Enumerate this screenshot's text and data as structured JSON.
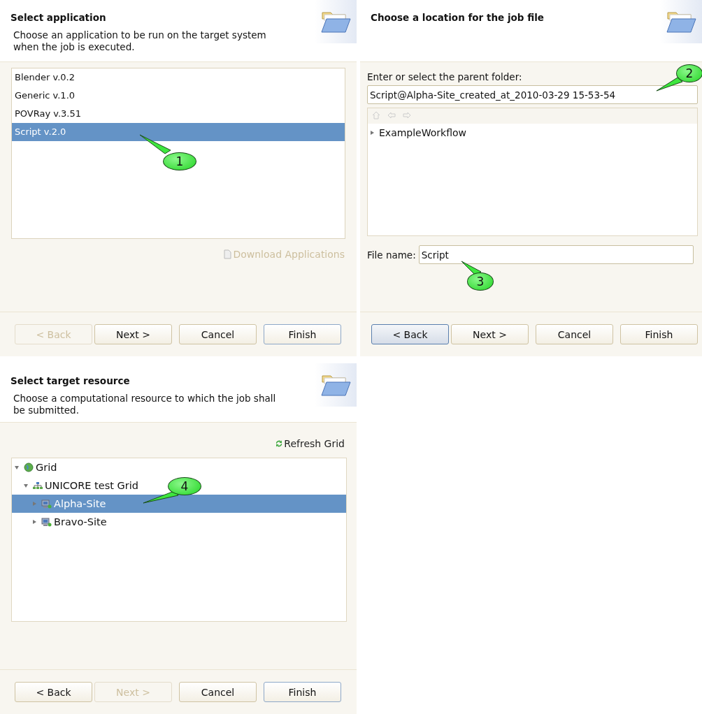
{
  "panels": [
    {
      "kind": "applications",
      "title": "Select application",
      "description": "Choose an application to be run on the target system when the job is executed.",
      "items": [
        {
          "label": "Blender v.0.2",
          "selected": false
        },
        {
          "label": "Generic v.1.0",
          "selected": false
        },
        {
          "label": "POVRay v.3.51",
          "selected": false
        },
        {
          "label": "Script v.2.0",
          "selected": true
        }
      ],
      "link": {
        "label": "Download Applications",
        "disabled": true
      },
      "buttons": [
        {
          "label": "< Back",
          "disabled": true,
          "focused": false,
          "default": false
        },
        {
          "label": "Next >",
          "disabled": false,
          "focused": false,
          "default": false
        },
        {
          "label": "Cancel",
          "disabled": false,
          "focused": false,
          "default": false
        },
        {
          "label": "Finish",
          "disabled": false,
          "focused": false,
          "default": true
        }
      ],
      "callouts": [
        "1"
      ]
    },
    {
      "kind": "location",
      "title": "Choose a location for the job file",
      "folder_label": "Enter or select the parent folder:",
      "folder_value": "Script@Alpha-Site_created_at_2010-03-29 15-53-54",
      "tree": [
        {
          "label": "ExampleWorkflow",
          "expanded": false,
          "selected": false
        }
      ],
      "file_label": "File name:",
      "file_value": "Script",
      "buttons": [
        {
          "label": "< Back",
          "disabled": false,
          "focused": true,
          "default": false
        },
        {
          "label": "Next >",
          "disabled": false,
          "focused": false,
          "default": false
        },
        {
          "label": "Cancel",
          "disabled": false,
          "focused": false,
          "default": false
        },
        {
          "label": "Finish",
          "disabled": false,
          "focused": false,
          "default": false
        }
      ],
      "callouts": [
        "2",
        "3"
      ]
    },
    {
      "kind": "resource",
      "title": "Select target resource",
      "description": "Choose a computational resource to which the job shall be submitted.",
      "link": {
        "label": "Refresh Grid",
        "disabled": false
      },
      "tree": [
        {
          "label": "Grid",
          "kind": "grid",
          "expanded": true,
          "selected": false,
          "children": [
            {
              "label": "UNICORE test Grid",
              "kind": "group",
              "expanded": true,
              "selected": false,
              "children": [
                {
                  "label": "Alpha-Site",
                  "kind": "site",
                  "expanded": false,
                  "selected": true
                },
                {
                  "label": "Bravo-Site",
                  "kind": "site",
                  "expanded": false,
                  "selected": false
                }
              ]
            }
          ]
        }
      ],
      "buttons": [
        {
          "label": "< Back",
          "disabled": false,
          "focused": false,
          "default": false
        },
        {
          "label": "Next >",
          "disabled": true,
          "focused": false,
          "default": false
        },
        {
          "label": "Cancel",
          "disabled": false,
          "focused": false,
          "default": false
        },
        {
          "label": "Finish",
          "disabled": false,
          "focused": false,
          "default": true
        }
      ],
      "callouts": [
        "4"
      ]
    }
  ]
}
